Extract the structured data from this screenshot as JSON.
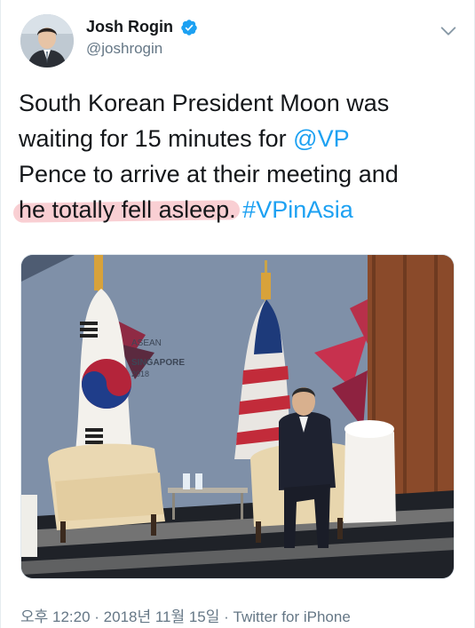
{
  "tweet": {
    "author": {
      "display_name": "Josh Rogin",
      "handle": "@joshrogin",
      "verified": true
    },
    "text": {
      "line1": "South Korean President Moon was",
      "line2a": "waiting for 15 minutes for ",
      "mention": "@VP",
      "line3": "Pence to arrive at their meeting and",
      "highlighted": "he totally fell asleep.",
      "hashtag": "#VPinAsia"
    },
    "photo": {
      "banner_line1": "ASEAN",
      "banner_line2": "SINGAPORE",
      "banner_line3": "2018"
    },
    "meta": {
      "time": "오후 12:20",
      "date": "2018년 11월 15일",
      "separator": " · ",
      "source": "Twitter for iPhone"
    },
    "colors": {
      "link": "#1da1f2",
      "secondary_text": "#657786",
      "highlight": "#f0828c"
    },
    "icons": [
      "verified-badge-icon",
      "chevron-down-icon"
    ]
  }
}
